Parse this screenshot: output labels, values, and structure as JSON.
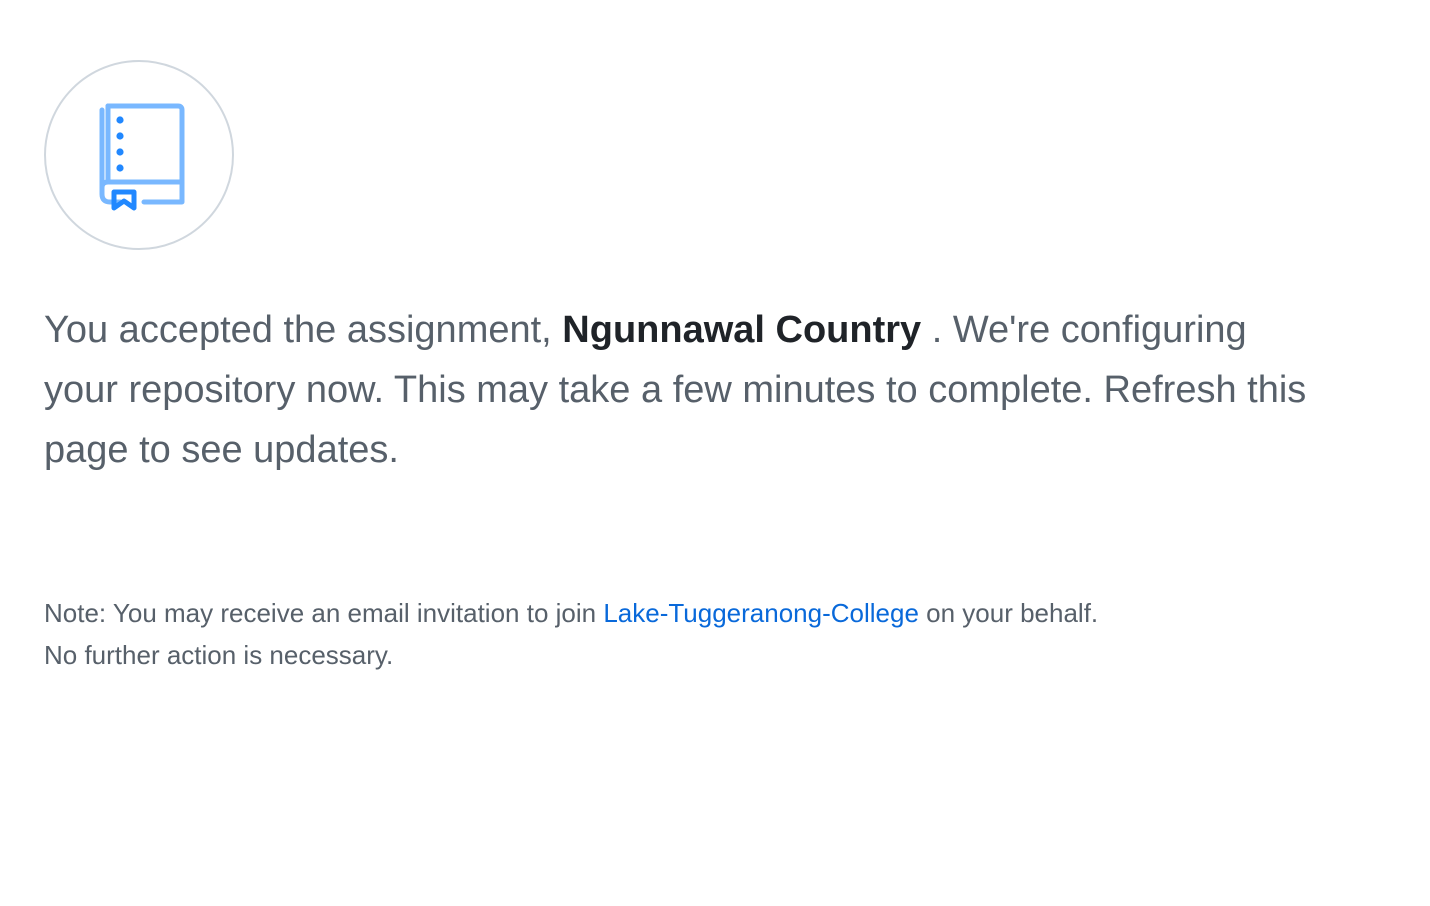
{
  "icon": {
    "name": "repo-book-icon",
    "colors": {
      "outline": "#79b8ff",
      "accent": "#2188ff",
      "circle_border": "#d0d7de"
    }
  },
  "message": {
    "prefix": "You accepted the assignment, ",
    "assignment_name": "Ngunnawal Country",
    "suffix": " . We're configuring your repository now. This may take a few minutes to complete. Refresh this page to see updates."
  },
  "note": {
    "prefix": "Note: You may receive an email invitation to join ",
    "org_link": "Lake-Tuggeranong-College",
    "suffix": " on your behalf.",
    "line2": "No further action is necessary."
  },
  "colors": {
    "text_muted": "#57606a",
    "text_strong": "#1f2328",
    "link": "#0969da"
  }
}
